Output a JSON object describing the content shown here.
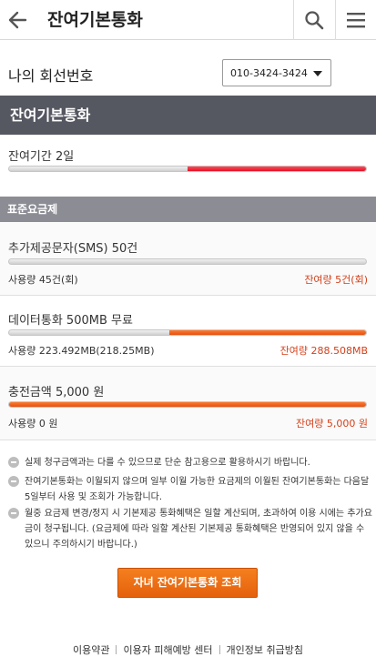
{
  "header": {
    "title": "잔여기본통화"
  },
  "line": {
    "label": "나의 회선번호",
    "selected": "010-3424-3424"
  },
  "section_title": "잔여기본통화",
  "period": {
    "label": "잔여기간 2일",
    "progress": 0.5
  },
  "plan_title": "표준요금제",
  "items": [
    {
      "name": "추가제공문자(SMS) 50건",
      "used": "사용량 45건(회)",
      "remain": "잔여량 5건(회)",
      "progress": 0
    },
    {
      "name": "데이터통화 500MB 무료",
      "used": "사용량 223.492MB(218.25MB)",
      "remain": "잔여량 288.508MB",
      "progress": 0.55
    },
    {
      "name": "충전금액 5,000 원",
      "used": "사용량 0 원",
      "remain": "잔여량 5,000 원",
      "progress": 1.0
    }
  ],
  "notes": [
    "실제 청구금액과는 다를 수 있으므로 단순 참고용으로 활용하시기 바랍니다.",
    "잔여기본통화는 이월되지 않으며 일부 이월 가능한 요금제의 이월된 잔여기본통화는 다음달 5일부터 사용 및 조회가 가능합니다.",
    "월중 요금제 변경/정지 시 기본제공 통화혜택은 일할 계산되며, 초과하여 이용 시에는 추가요금이 청구됩니다. (요금제에 따라 일할 계산된 기본제공 통화혜택은 반영되어 있지 않을 수 있으니 주의하시기 바랍니다.)"
  ],
  "child_button": "자녀 잔여기본통화 조회",
  "footer": {
    "terms": "이용약관",
    "protection": "이용자 피해예방 센터",
    "privacy": "개인정보 취급방침"
  },
  "icons": {
    "back": "back-arrow-icon",
    "search": "search-icon",
    "menu": "hamburger-menu-icon"
  },
  "colors": {
    "accent_orange": "#e8500f",
    "accent_red": "#e1132a",
    "section_dark": "#555761",
    "section_gray": "#8c8d94",
    "remain_text": "#d3401a"
  }
}
